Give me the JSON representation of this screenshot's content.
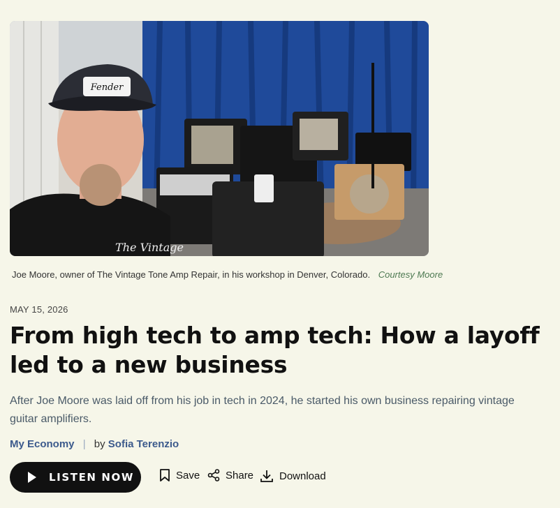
{
  "photo": {
    "alt": "Man in a Fender cap taking a selfie in a room full of vintage guitar amplifiers",
    "cap_text": "The Vintage"
  },
  "caption": {
    "text": "Joe Moore, owner of The Vintage Tone Amp Repair, in his workshop in Denver, Colorado.",
    "credit": "Courtesy Moore"
  },
  "article": {
    "date": "MAY 15, 2026",
    "headline": "From high tech to amp tech: How a layoff led to a new business",
    "dek": "After Joe Moore was laid off from his job in tech in 2024, he started his own business repairing vintage guitar amplifiers.",
    "section": "My Economy",
    "separator": "|",
    "by": "by",
    "author": "Sofia Terenzio"
  },
  "actions": {
    "listen_label": "LISTEN NOW",
    "save_label": "Save",
    "share_label": "Share",
    "download_label": "Download"
  },
  "colors": {
    "background": "#f6f6e9",
    "link": "#3c5a8c",
    "credit": "#4e7a52",
    "listen_bg": "#111111"
  }
}
